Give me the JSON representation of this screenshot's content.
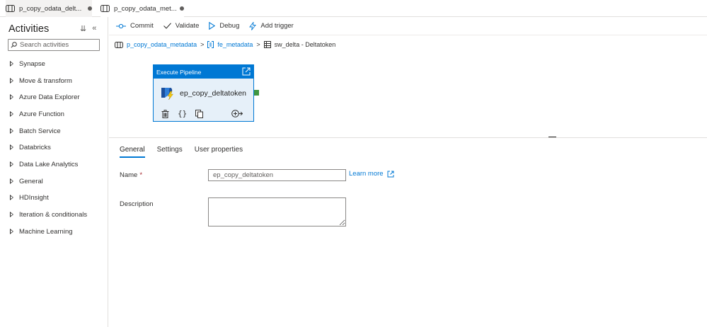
{
  "tabs": [
    {
      "label": "p_copy_odata_delt...",
      "active": false,
      "unsaved": true
    },
    {
      "label": "p_copy_odata_met...",
      "active": true,
      "unsaved": true
    }
  ],
  "sidebar": {
    "title": "Activities",
    "search_placeholder": "Search activities",
    "categories": [
      "Synapse",
      "Move & transform",
      "Azure Data Explorer",
      "Azure Function",
      "Batch Service",
      "Databricks",
      "Data Lake Analytics",
      "General",
      "HDInsight",
      "Iteration & conditionals",
      "Machine Learning"
    ]
  },
  "toolbar": {
    "commit": "Commit",
    "validate": "Validate",
    "debug": "Debug",
    "add_trigger": "Add trigger"
  },
  "breadcrumb": {
    "pipeline": "p_copy_odata_metadata",
    "foreach": "fe_metadata",
    "switch": "sw_delta - Deltatoken"
  },
  "activity": {
    "type": "Execute Pipeline",
    "name": "ep_copy_deltatoken"
  },
  "properties": {
    "tabs": [
      "General",
      "Settings",
      "User properties"
    ],
    "active_tab": "General",
    "name_label": "Name",
    "required_mark": "*",
    "name_value": "ep_copy_deltatoken",
    "learn_more": "Learn more",
    "description_label": "Description",
    "description_value": ""
  },
  "colors": {
    "accent": "#0078d4",
    "output_connector": "#107c10"
  }
}
